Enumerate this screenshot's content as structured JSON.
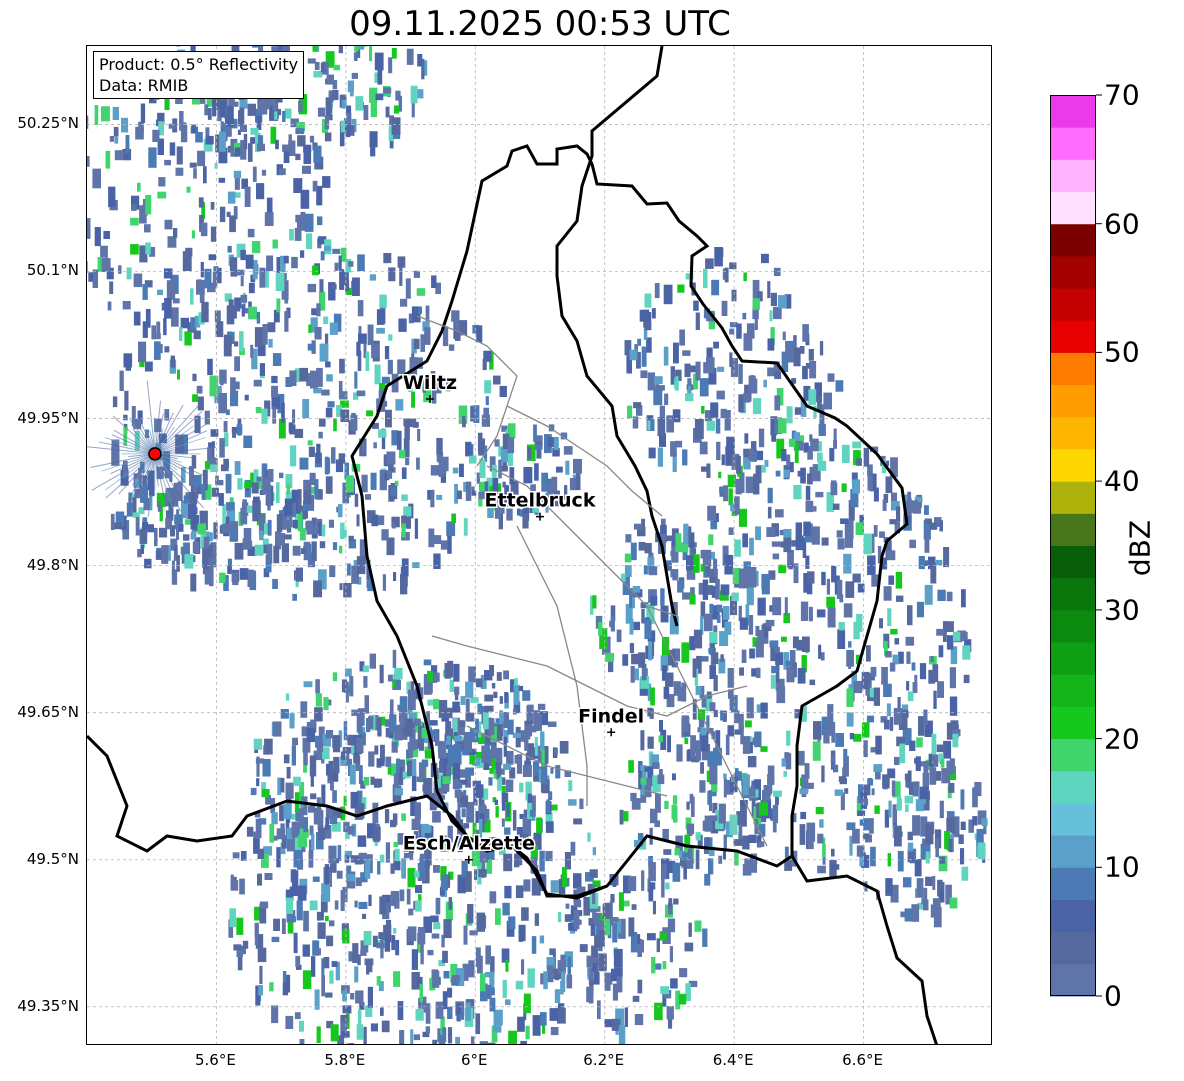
{
  "title": "09.11.2025 00:53 UTC",
  "info": {
    "product": "Product: 0.5° Reflectivity",
    "data": "Data: RMIB"
  },
  "axes": {
    "x_ticks": [
      "5.6°E",
      "5.8°E",
      "6°E",
      "6.2°E",
      "6.4°E",
      "6.6°E"
    ],
    "y_ticks": [
      "50.25°N",
      "50.1°N",
      "49.95°N",
      "49.8°N",
      "49.65°N",
      "49.5°N",
      "49.35°N"
    ],
    "grid": true
  },
  "cities": [
    {
      "name": "Wiltz",
      "lon": 5.93,
      "lat": 49.97
    },
    {
      "name": "Ettelbruck",
      "lon": 6.1,
      "lat": 49.85
    },
    {
      "name": "Findel",
      "lon": 6.21,
      "lat": 49.63
    },
    {
      "name": "Esch/Alzette",
      "lon": 5.99,
      "lat": 49.5
    }
  ],
  "radar_site": {
    "lon": 5.505,
    "lat": 49.914
  },
  "colorbar": {
    "label": "dBZ",
    "ticks": [
      "0",
      "10",
      "20",
      "30",
      "40",
      "50",
      "60",
      "70"
    ],
    "colors": [
      "#5f74a8",
      "#56699f",
      "#4a62a6",
      "#4b7ab4",
      "#5aa0c8",
      "#66c0da",
      "#5fd5c0",
      "#3fd46c",
      "#16c71d",
      "#13b51a",
      "#0f9f14",
      "#0c8a10",
      "#0a770d",
      "#095f09",
      "#47771a",
      "#adb30a",
      "#ffd700",
      "#ffb600",
      "#ff9c00",
      "#ff7b00",
      "#e60000",
      "#c50000",
      "#a30000",
      "#7d0000",
      "#ffe1ff",
      "#ffb3ff",
      "#ff6cff",
      "#ea3aea"
    ]
  }
}
